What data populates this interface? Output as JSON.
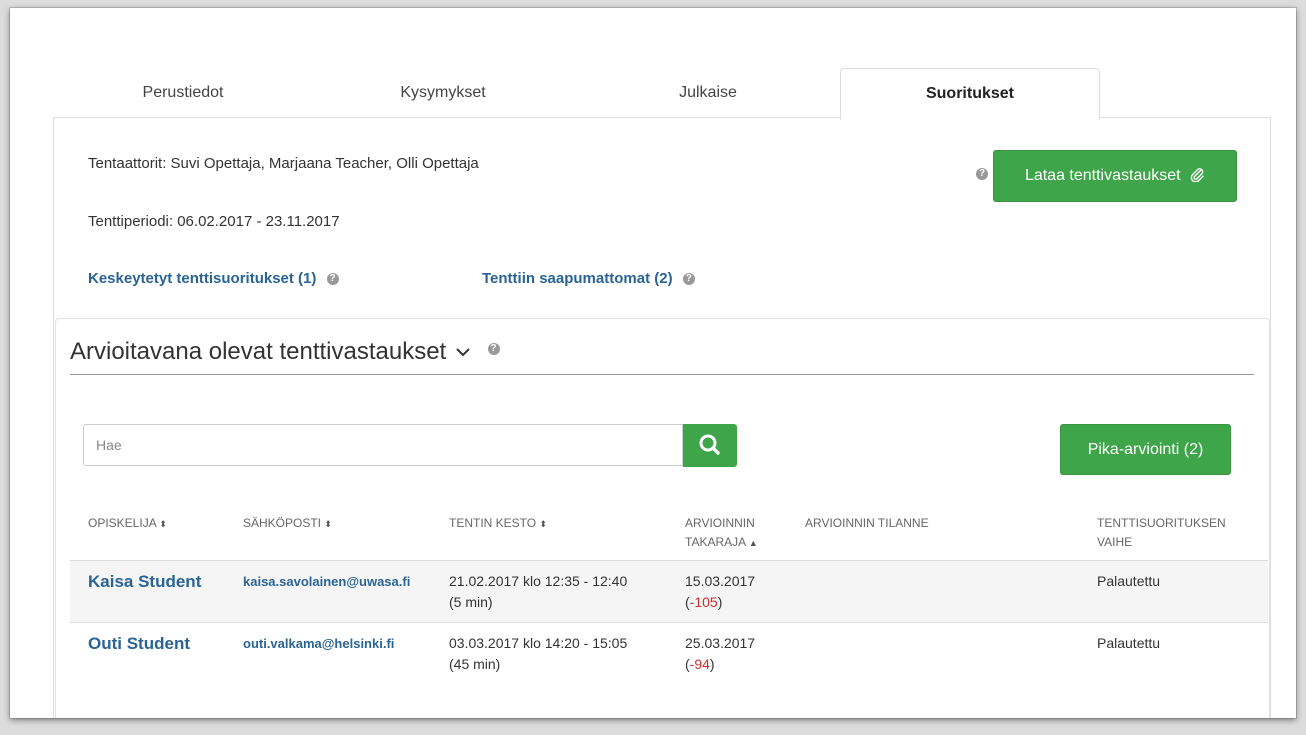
{
  "tabs": [
    {
      "label": "Perustiedot",
      "active": false
    },
    {
      "label": "Kysymykset",
      "active": false
    },
    {
      "label": "Julkaise",
      "active": false
    },
    {
      "label": "Suoritukset",
      "active": true
    }
  ],
  "info": {
    "examiners": "Tentaattorit: Suvi Opettaja, Marjaana Teacher, Olli Opettaja",
    "period": "Tenttiperiodi: 06.02.2017 - 23.11.2017",
    "download_label": "Lataa tenttivastaukset",
    "aborted_link": "Keskeytetyt tenttisuoritukset (1)",
    "noshow_link": "Tenttiin saapumattomat (2)"
  },
  "section": {
    "title": "Arvioitavana olevat tenttivastaukset",
    "search_placeholder": "Hae",
    "quick_review_label": "Pika-arviointi (2)"
  },
  "table": {
    "headers": [
      {
        "line1": "OPISKELIJA",
        "line2": "",
        "sort": "⬍"
      },
      {
        "line1": "SÄHKÖPOSTI",
        "line2": "",
        "sort": "⬍"
      },
      {
        "line1": "TENTIN KESTO",
        "line2": "",
        "sort": "⬍"
      },
      {
        "line1": "ARVIOINNIN",
        "line2": "TAKARAJA",
        "sort": "▲"
      },
      {
        "line1": "ARVIOINNIN TILANNE",
        "line2": "",
        "sort": ""
      },
      {
        "line1": "TENTTISUORITUKSEN",
        "line2": "VAIHE",
        "sort": ""
      }
    ],
    "rows": [
      {
        "student": "Kaisa Student",
        "email": "kaisa.savolainen@uwasa.fi",
        "duration_time": "21.02.2017 klo 12:35 - 12:40",
        "duration_len": "(5 min)",
        "deadline": "15.03.2017",
        "days_left": "-105",
        "review_status": "",
        "phase": "Palautettu"
      },
      {
        "student": "Outi Student",
        "email": "outi.valkama@helsinki.fi",
        "duration_time": "03.03.2017 klo 14:20 - 15:05",
        "duration_len": "(45 min)",
        "deadline": "25.03.2017",
        "days_left": "-94",
        "review_status": "",
        "phase": "Palautettu"
      }
    ]
  },
  "icons": {
    "help": "question-circle-icon",
    "attachment": "paperclip-icon",
    "search": "search-icon",
    "chevron": "chevron-down-icon"
  },
  "colors": {
    "accent_green": "#3fa54a",
    "link_blue": "#2a6496",
    "negative_red": "#c9302c"
  }
}
